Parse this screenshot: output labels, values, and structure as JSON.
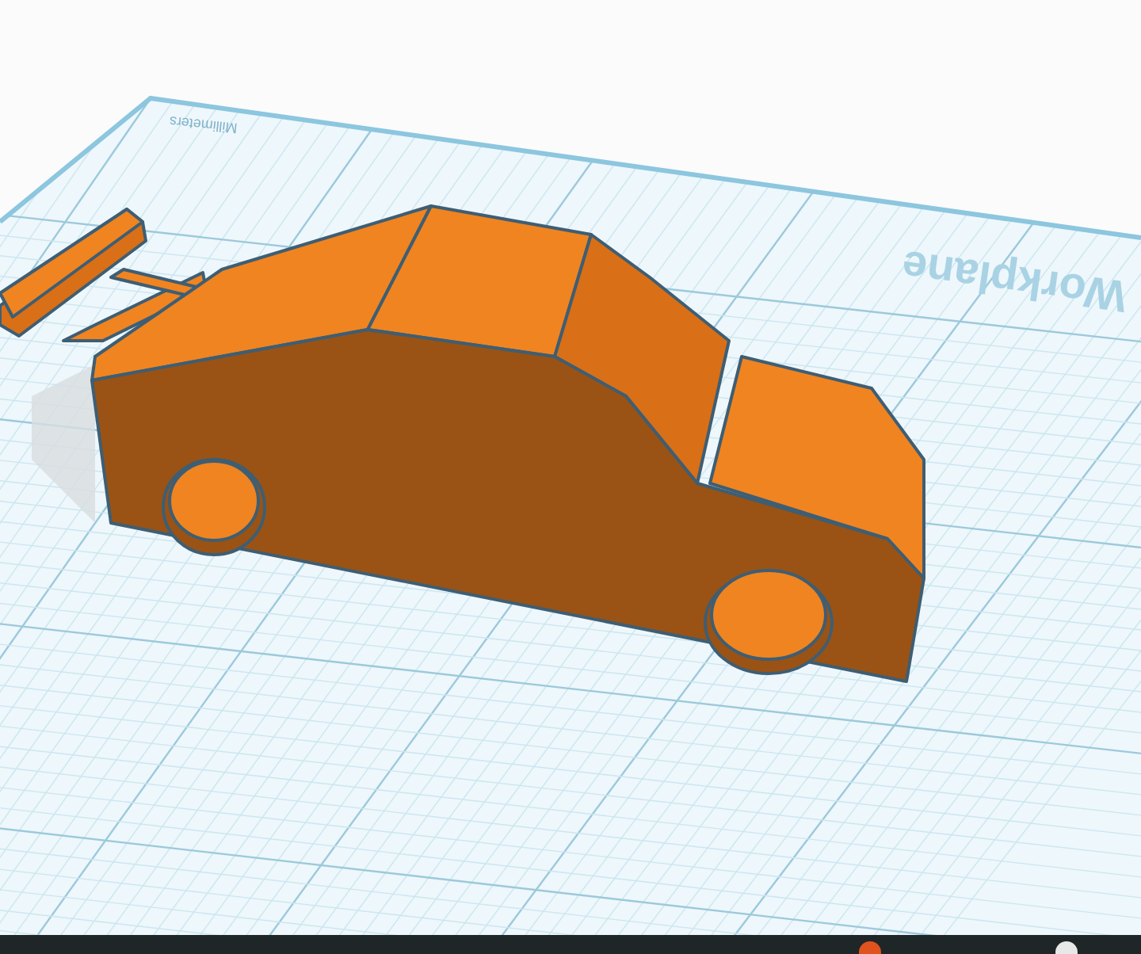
{
  "workplane": {
    "title": "Workplane",
    "units": "Millimeters"
  }
}
